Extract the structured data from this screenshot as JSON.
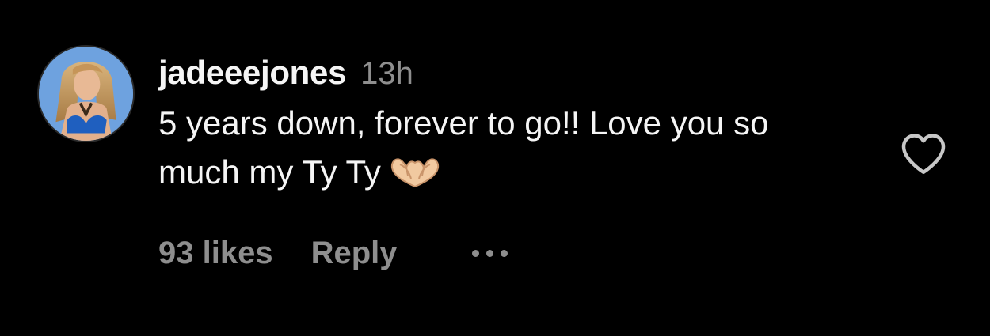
{
  "comment": {
    "username": "jadeeejones",
    "timestamp": "13h",
    "text": "5 years down, forever to go!! Love you so much my Ty Ty",
    "emoji": "heart-hands-emoji",
    "likes": "93 likes",
    "reply_label": "Reply",
    "more_icon": "more-options-icon",
    "like_icon": "heart-outline-icon"
  },
  "colors": {
    "background": "#000000",
    "primary_text": "#f5f5f5",
    "secondary_text": "#8e8e8e",
    "icon": "#c7c7c7"
  }
}
